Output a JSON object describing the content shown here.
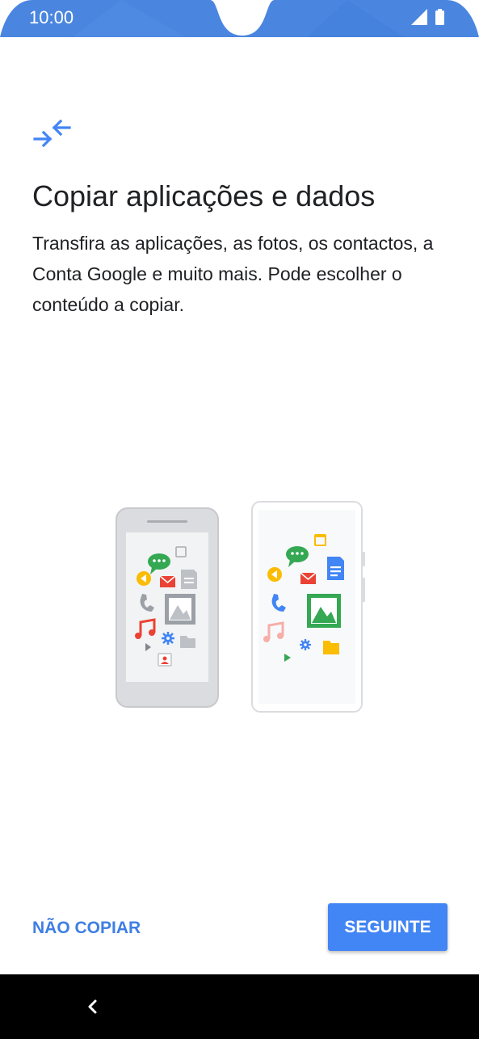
{
  "status_bar": {
    "time": "10:00",
    "icons": [
      "signal-icon",
      "battery-icon"
    ],
    "color": "#4a86e0"
  },
  "screen": {
    "header_icon": "copy-transfer-icon",
    "title": "Copiar aplicações e dados",
    "description": "Transfira as aplicações, as fotos, os contactos, a Conta Google e muito mais. Pode escolher o conteúdo a copiar.",
    "illustration": "old-phone-to-new-phone-illustration"
  },
  "actions": {
    "skip_label": "NÃO COPIAR",
    "next_label": "SEGUINTE"
  },
  "nav_bar": {
    "back_icon": "back-icon"
  },
  "colors": {
    "accent": "#4285f4",
    "link": "#3f7ee4",
    "text": "#202124",
    "nav_background": "#000000"
  }
}
